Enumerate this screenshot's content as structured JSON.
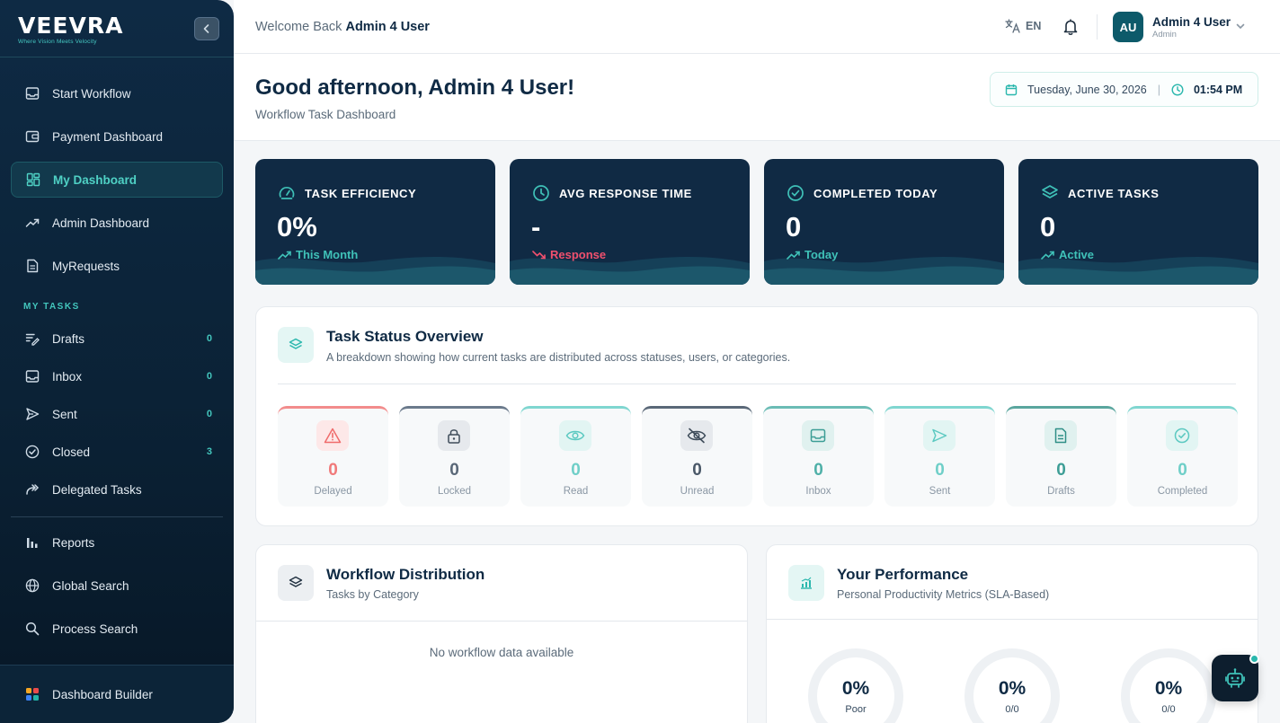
{
  "brand": {
    "name": "VEEVRA",
    "tagline": "Where Vision Meets Velocity"
  },
  "sidebar": {
    "main_items": [
      {
        "label": "Start Workflow",
        "icon": "inbox-tray-icon"
      },
      {
        "label": "Payment Dashboard",
        "icon": "wallet-icon"
      },
      {
        "label": "My Dashboard",
        "icon": "dashboard-grid-icon",
        "active": true
      },
      {
        "label": "Admin Dashboard",
        "icon": "trending-up-icon"
      },
      {
        "label": "MyRequests",
        "icon": "document-icon"
      }
    ],
    "section_label": "MY TASKS",
    "task_items": [
      {
        "label": "Drafts",
        "count": "0",
        "icon": "edit-lines-icon"
      },
      {
        "label": "Inbox",
        "count": "0",
        "icon": "inbox-tray-icon"
      },
      {
        "label": "Sent",
        "count": "0",
        "icon": "send-icon"
      },
      {
        "label": "Closed",
        "count": "3",
        "icon": "check-circle-icon"
      },
      {
        "label": "Delegated Tasks",
        "icon": "forward-icon"
      }
    ],
    "tool_items": [
      {
        "label": "Reports",
        "icon": "bar-chart-icon"
      },
      {
        "label": "Global Search",
        "icon": "globe-icon"
      },
      {
        "label": "Process Search",
        "icon": "search-icon"
      }
    ],
    "bottom_item": {
      "label": "Dashboard Builder",
      "icon": "builder-grid-icon"
    }
  },
  "header": {
    "welcome_prefix": "Welcome Back",
    "welcome_user": "Admin 4 User",
    "language": "EN",
    "avatar_initials": "AU",
    "user_name": "Admin 4 User",
    "user_role": "Admin"
  },
  "greeting": {
    "title": "Good afternoon, Admin 4 User!",
    "subtitle": "Workflow Task Dashboard",
    "date": "Tuesday, June 30, 2026",
    "time": "01:54 PM"
  },
  "stats": [
    {
      "label": "TASK EFFICIENCY",
      "value": "0%",
      "trend": "This Month",
      "trend_dir": "up"
    },
    {
      "label": "AVG RESPONSE TIME",
      "value": "-",
      "trend": "Response",
      "trend_dir": "down"
    },
    {
      "label": "COMPLETED TODAY",
      "value": "0",
      "trend": "Today",
      "trend_dir": "up"
    },
    {
      "label": "ACTIVE TASKS",
      "value": "0",
      "trend": "Active",
      "trend_dir": "up"
    }
  ],
  "task_overview": {
    "title": "Task Status Overview",
    "subtitle": "A breakdown showing how current tasks are distributed across statuses, users, or categories.",
    "statuses": [
      {
        "label": "Delayed",
        "count": "0",
        "color": "#f07a7a"
      },
      {
        "label": "Locked",
        "count": "0",
        "color": "#5f6f82"
      },
      {
        "label": "Read",
        "count": "0",
        "color": "#7fd6d0"
      },
      {
        "label": "Unread",
        "count": "0",
        "color": "#4a5868"
      },
      {
        "label": "Inbox",
        "count": "0",
        "color": "#5cb8b0"
      },
      {
        "label": "Sent",
        "count": "0",
        "color": "#7fd6d0"
      },
      {
        "label": "Drafts",
        "count": "0",
        "color": "#4fa89f"
      },
      {
        "label": "Completed",
        "count": "0",
        "color": "#7fd6d0"
      }
    ]
  },
  "workflow": {
    "title": "Workflow Distribution",
    "subtitle": "Tasks by Category",
    "empty": "No workflow data available"
  },
  "performance": {
    "title": "Your Performance",
    "subtitle": "Personal Productivity Metrics (SLA-Based)",
    "gauges": [
      {
        "value": "0%",
        "label": "Poor"
      },
      {
        "value": "0%",
        "label": "0/0"
      },
      {
        "value": "0%",
        "label": "0/0"
      }
    ]
  }
}
